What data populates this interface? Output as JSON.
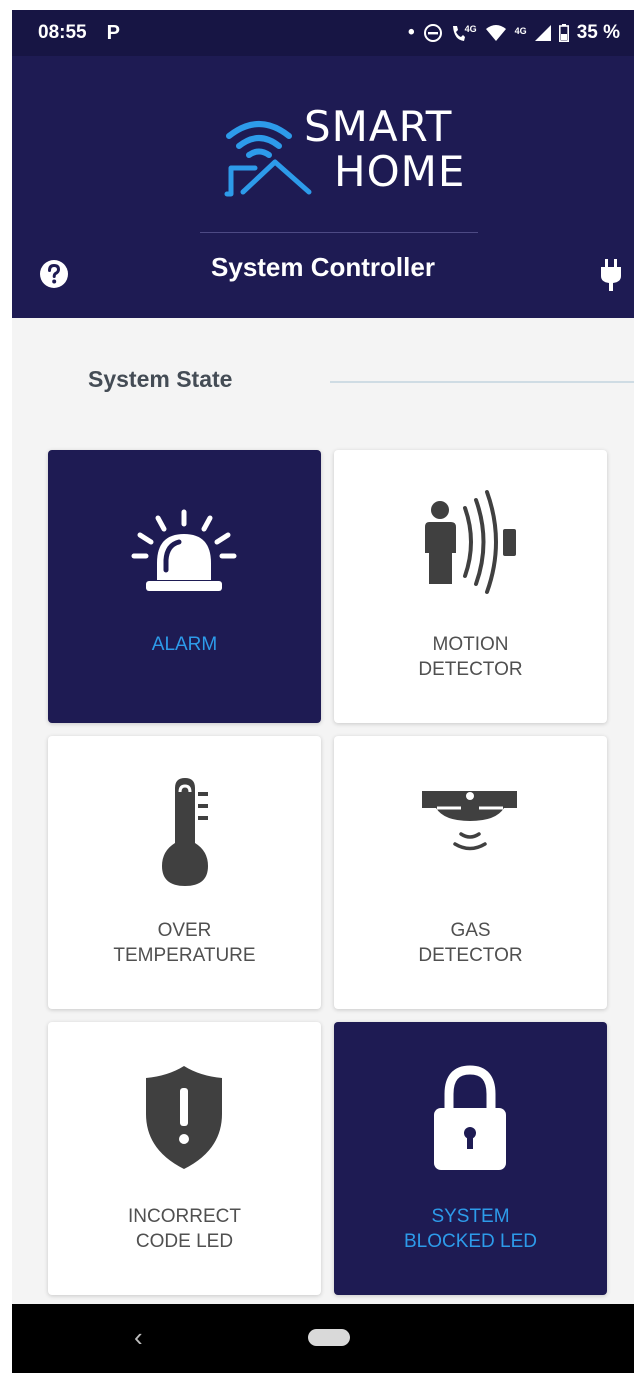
{
  "status_bar": {
    "time": "08:55",
    "notification": "P",
    "network_1": "4G",
    "network_2": "4G",
    "battery": "35 %"
  },
  "header": {
    "logo_line1": "SMART",
    "logo_line2": "HOME",
    "title": "System Controller",
    "left_icon": "help-icon",
    "right_icon": "plug-icon"
  },
  "section": {
    "title": "System State"
  },
  "tiles": [
    {
      "line1": "ALARM",
      "line2": "",
      "icon": "alarm-siren-icon",
      "active": true
    },
    {
      "line1": "MOTION",
      "line2": "DETECTOR",
      "icon": "motion-detector-icon",
      "active": false
    },
    {
      "line1": "OVER",
      "line2": "TEMPERATURE",
      "icon": "thermometer-icon",
      "active": false
    },
    {
      "line1": "GAS",
      "line2": "DETECTOR",
      "icon": "gas-detector-icon",
      "active": false
    },
    {
      "line1": "INCORRECT",
      "line2": "CODE LED",
      "icon": "shield-warning-icon",
      "active": false
    },
    {
      "line1": "SYSTEM",
      "line2": "BLOCKED LED",
      "icon": "padlock-icon",
      "active": true
    }
  ],
  "nav": {
    "back": "‹"
  },
  "colors": {
    "header_bg": "#1e1b53",
    "status_bg": "#171544",
    "accent_blue": "#2d9bea",
    "page_bg": "#f4f4f4"
  }
}
